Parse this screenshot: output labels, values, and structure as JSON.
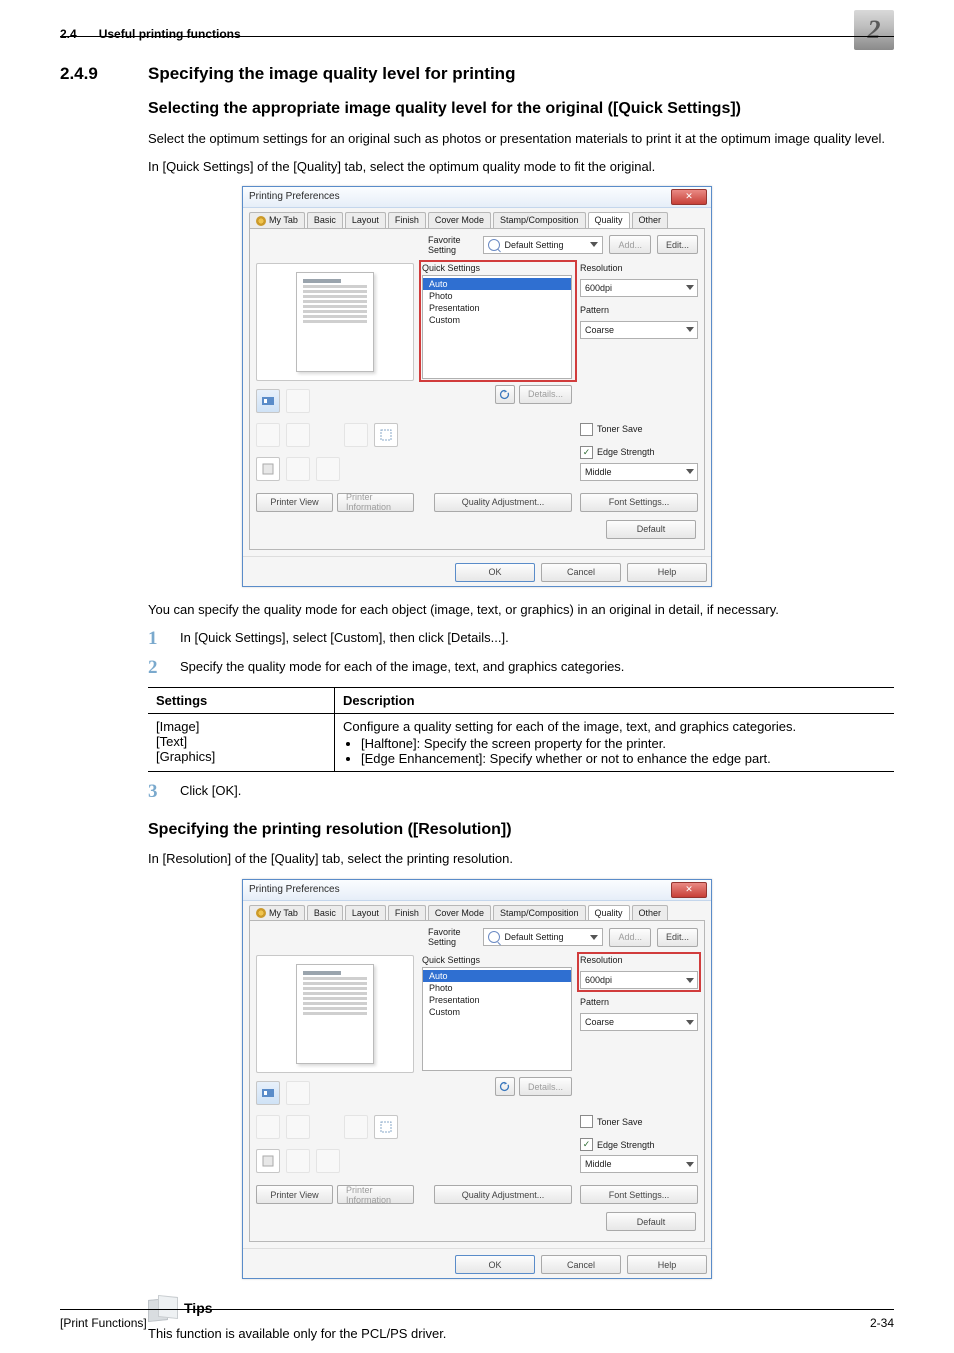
{
  "header": {
    "section": "2.4",
    "title": "Useful printing functions",
    "chapter": "2"
  },
  "h249": {
    "num": "2.4.9",
    "title": "Specifying the image quality level for printing"
  },
  "sub1": {
    "title": "Selecting the appropriate image quality level for the original ([Quick Settings])",
    "p1": "Select the optimum settings for an original such as photos or presentation materials to print it at the optimum image quality level.",
    "p2": "In [Quick Settings] of the [Quality] tab, select the optimum quality mode to fit the original."
  },
  "dialog": {
    "window_title": "Printing Preferences",
    "close_glyph": "✕",
    "tabs": {
      "mytab": "My Tab",
      "basic": "Basic",
      "layout": "Layout",
      "finish": "Finish",
      "cover": "Cover Mode",
      "stamp": "Stamp/Composition",
      "quality": "Quality",
      "other": "Other"
    },
    "favorite": {
      "label": "Favorite Setting",
      "value": "Default Setting",
      "add": "Add...",
      "edit": "Edit..."
    },
    "quick": {
      "label": "Quick Settings",
      "items": {
        "auto": "Auto",
        "photo": "Photo",
        "presentation": "Presentation",
        "custom": "Custom"
      },
      "details": "Details..."
    },
    "resolution": {
      "label": "Resolution",
      "value": "600dpi"
    },
    "pattern": {
      "label": "Pattern",
      "value": "Coarse"
    },
    "toner_save": "Toner Save",
    "edge": {
      "label": "Edge Strength",
      "value": "Middle"
    },
    "q_adjust": "Quality Adjustment...",
    "font_settings": "Font Settings...",
    "printer_view": "Printer View",
    "printer_info": "Printer Information",
    "default_btn": "Default",
    "ok": "OK",
    "cancel": "Cancel",
    "help": "Help"
  },
  "after_img": {
    "p": "You can specify the quality mode for each object (image, text, or graphics) in an original in detail, if necessary."
  },
  "steps": {
    "s1": "In [Quick Settings], select [Custom], then click [Details...].",
    "s2": "Specify the quality mode for each of the image, text, and graphics categories.",
    "s3": "Click [OK]."
  },
  "table": {
    "h1": "Settings",
    "h2": "Description",
    "r1c1a": "[Image]",
    "r1c1b": "[Text]",
    "r1c1c": "[Graphics]",
    "r1c2_intro": "Configure a quality setting for each of the image, text, and graphics categories.",
    "r1c2_b1": "[Halftone]: Specify the screen property for the printer.",
    "r1c2_b2": "[Edge Enhancement]: Specify whether or not to enhance the edge part."
  },
  "sub2": {
    "title": "Specifying the printing resolution ([Resolution])",
    "p1": "In [Resolution] of the [Quality] tab, select the printing resolution."
  },
  "tips": {
    "label": "Tips",
    "text": "This function is available only for the PCL/PS driver."
  },
  "footer": {
    "left": "[Print Functions]",
    "right": "2-34"
  }
}
